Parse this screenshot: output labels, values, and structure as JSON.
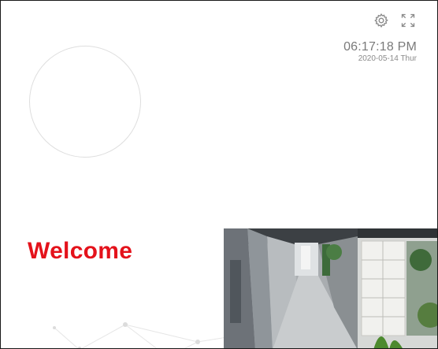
{
  "header": {
    "icons": [
      "settings-gear-icon",
      "fullscreen-expand-icon"
    ]
  },
  "clock": {
    "time": "06:17:18 PM",
    "date": "2020-05-14 Thur"
  },
  "welcome": {
    "text": "Welcome",
    "color": "#e4121b"
  },
  "camera": {
    "feeds": [
      "corridor",
      "office-shelves"
    ]
  },
  "colors": {
    "accent": "#e4121b",
    "text_muted": "#7a7a7a"
  }
}
